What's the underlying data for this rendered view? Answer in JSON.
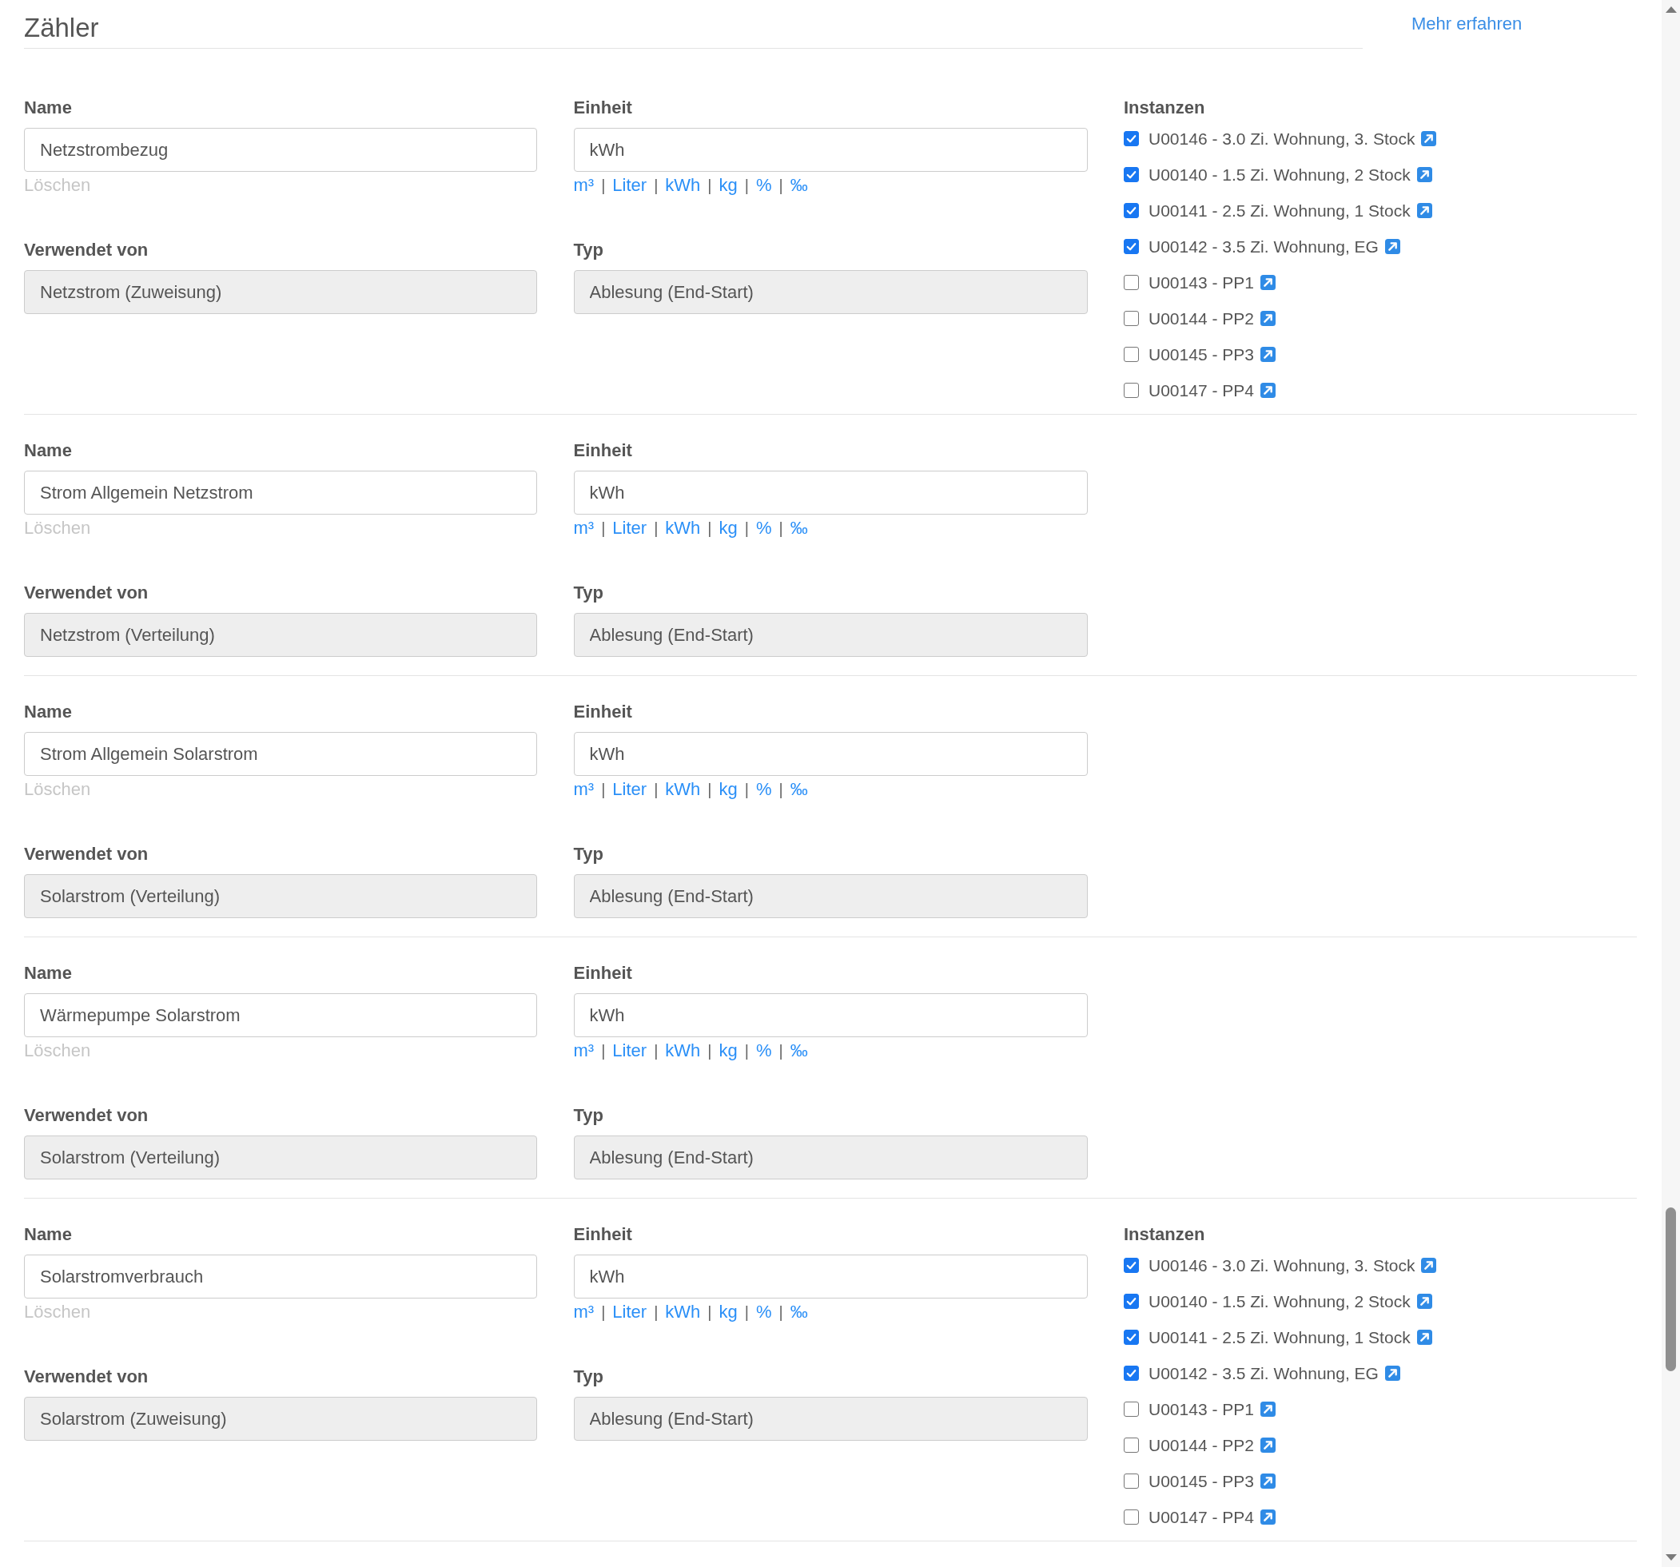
{
  "title": "Zähler",
  "more_link": "Mehr erfahren",
  "sections": [
    {
      "name": {
        "label": "Name",
        "value": "Netzstrombezug",
        "readonly": false
      },
      "delete_link": "Löschen",
      "unit": {
        "label": "Einheit",
        "value": "kWh",
        "readonly": false
      },
      "unit_options": [
        {
          "kind": "link",
          "text": "m³"
        },
        {
          "kind": "separator",
          "text": "|"
        },
        {
          "kind": "link",
          "text": "Liter"
        },
        {
          "kind": "separator",
          "text": "|"
        },
        {
          "kind": "link",
          "text": "kWh"
        },
        {
          "kind": "separator",
          "text": "|"
        },
        {
          "kind": "link",
          "text": "kg"
        },
        {
          "kind": "separator",
          "text": "|"
        },
        {
          "kind": "link",
          "text": "%"
        },
        {
          "kind": "separator",
          "text": "|"
        },
        {
          "kind": "link",
          "text": "‰"
        }
      ],
      "used_by": {
        "label": "Verwendet von",
        "value": "Netzstrom (Zuweisung)",
        "readonly": true
      },
      "type": {
        "label": "Typ",
        "value": "Ablesung (End-Start)",
        "readonly": true
      },
      "instances": {
        "label": "Instanzen",
        "items": [
          {
            "text": "U00146 - 3.0 Zi. Wohnung, 3. Stock",
            "checked": true
          },
          {
            "text": "U00140 - 1.5 Zi. Wohnung, 2 Stock",
            "checked": true
          },
          {
            "text": "U00141 - 2.5 Zi. Wohnung, 1 Stock",
            "checked": true
          },
          {
            "text": "U00142 - 3.5 Zi. Wohnung, EG",
            "checked": true
          },
          {
            "text": "U00143 - PP1",
            "checked": false
          },
          {
            "text": "U00144 - PP2",
            "checked": false
          },
          {
            "text": "U00145 - PP3",
            "checked": false
          },
          {
            "text": "U00147 - PP4",
            "checked": false
          }
        ]
      }
    },
    {
      "name": {
        "label": "Name",
        "value": "Strom Allgemein Netzstrom",
        "readonly": false
      },
      "delete_link": "Löschen",
      "unit": {
        "label": "Einheit",
        "value": "kWh",
        "readonly": false
      },
      "unit_options": [
        {
          "kind": "link",
          "text": "m³"
        },
        {
          "kind": "separator",
          "text": "|"
        },
        {
          "kind": "link",
          "text": "Liter"
        },
        {
          "kind": "separator",
          "text": "|"
        },
        {
          "kind": "link",
          "text": "kWh"
        },
        {
          "kind": "separator",
          "text": "|"
        },
        {
          "kind": "link",
          "text": "kg"
        },
        {
          "kind": "separator",
          "text": "|"
        },
        {
          "kind": "link",
          "text": "%"
        },
        {
          "kind": "separator",
          "text": "|"
        },
        {
          "kind": "link",
          "text": "‰"
        }
      ],
      "used_by": {
        "label": "Verwendet von",
        "value": "Netzstrom (Verteilung)",
        "readonly": true
      },
      "type": {
        "label": "Typ",
        "value": "Ablesung (End-Start)",
        "readonly": true
      }
    },
    {
      "name": {
        "label": "Name",
        "value": "Strom Allgemein Solarstrom",
        "readonly": false
      },
      "delete_link": "Löschen",
      "unit": {
        "label": "Einheit",
        "value": "kWh",
        "readonly": false
      },
      "unit_options": [
        {
          "kind": "link",
          "text": "m³"
        },
        {
          "kind": "separator",
          "text": "|"
        },
        {
          "kind": "link",
          "text": "Liter"
        },
        {
          "kind": "separator",
          "text": "|"
        },
        {
          "kind": "link",
          "text": "kWh"
        },
        {
          "kind": "separator",
          "text": "|"
        },
        {
          "kind": "link",
          "text": "kg"
        },
        {
          "kind": "separator",
          "text": "|"
        },
        {
          "kind": "link",
          "text": "%"
        },
        {
          "kind": "separator",
          "text": "|"
        },
        {
          "kind": "link",
          "text": "‰"
        }
      ],
      "used_by": {
        "label": "Verwendet von",
        "value": "Solarstrom (Verteilung)",
        "readonly": true
      },
      "type": {
        "label": "Typ",
        "value": "Ablesung (End-Start)",
        "readonly": true
      }
    },
    {
      "name": {
        "label": "Name",
        "value": "Wärmepumpe Solarstrom",
        "readonly": false
      },
      "delete_link": "Löschen",
      "unit": {
        "label": "Einheit",
        "value": "kWh",
        "readonly": false
      },
      "unit_options": [
        {
          "kind": "link",
          "text": "m³"
        },
        {
          "kind": "separator",
          "text": "|"
        },
        {
          "kind": "link",
          "text": "Liter"
        },
        {
          "kind": "separator",
          "text": "|"
        },
        {
          "kind": "link",
          "text": "kWh"
        },
        {
          "kind": "separator",
          "text": "|"
        },
        {
          "kind": "link",
          "text": "kg"
        },
        {
          "kind": "separator",
          "text": "|"
        },
        {
          "kind": "link",
          "text": "%"
        },
        {
          "kind": "separator",
          "text": "|"
        },
        {
          "kind": "link",
          "text": "‰"
        }
      ],
      "used_by": {
        "label": "Verwendet von",
        "value": "Solarstrom (Verteilung)",
        "readonly": true
      },
      "type": {
        "label": "Typ",
        "value": "Ablesung (End-Start)",
        "readonly": true
      }
    },
    {
      "name": {
        "label": "Name",
        "value": "Solarstromverbrauch",
        "readonly": false
      },
      "delete_link": "Löschen",
      "unit": {
        "label": "Einheit",
        "value": "kWh",
        "readonly": false
      },
      "unit_options": [
        {
          "kind": "link",
          "text": "m³"
        },
        {
          "kind": "separator",
          "text": "|"
        },
        {
          "kind": "link",
          "text": "Liter"
        },
        {
          "kind": "separator",
          "text": "|"
        },
        {
          "kind": "link",
          "text": "kWh"
        },
        {
          "kind": "separator",
          "text": "|"
        },
        {
          "kind": "link",
          "text": "kg"
        },
        {
          "kind": "separator",
          "text": "|"
        },
        {
          "kind": "link",
          "text": "%"
        },
        {
          "kind": "separator",
          "text": "|"
        },
        {
          "kind": "link",
          "text": "‰"
        }
      ],
      "used_by": {
        "label": "Verwendet von",
        "value": "Solarstrom (Zuweisung)",
        "readonly": true
      },
      "type": {
        "label": "Typ",
        "value": "Ablesung (End-Start)",
        "readonly": true
      },
      "instances": {
        "label": "Instanzen",
        "items": [
          {
            "text": "U00146 - 3.0 Zi. Wohnung, 3. Stock",
            "checked": true
          },
          {
            "text": "U00140 - 1.5 Zi. Wohnung, 2 Stock",
            "checked": true
          },
          {
            "text": "U00141 - 2.5 Zi. Wohnung, 1 Stock",
            "checked": true
          },
          {
            "text": "U00142 - 3.5 Zi. Wohnung, EG",
            "checked": true
          },
          {
            "text": "U00143 - PP1",
            "checked": false
          },
          {
            "text": "U00144 - PP2",
            "checked": false
          },
          {
            "text": "U00145 - PP3",
            "checked": false
          },
          {
            "text": "U00147 - PP4",
            "checked": false
          }
        ]
      }
    }
  ]
}
